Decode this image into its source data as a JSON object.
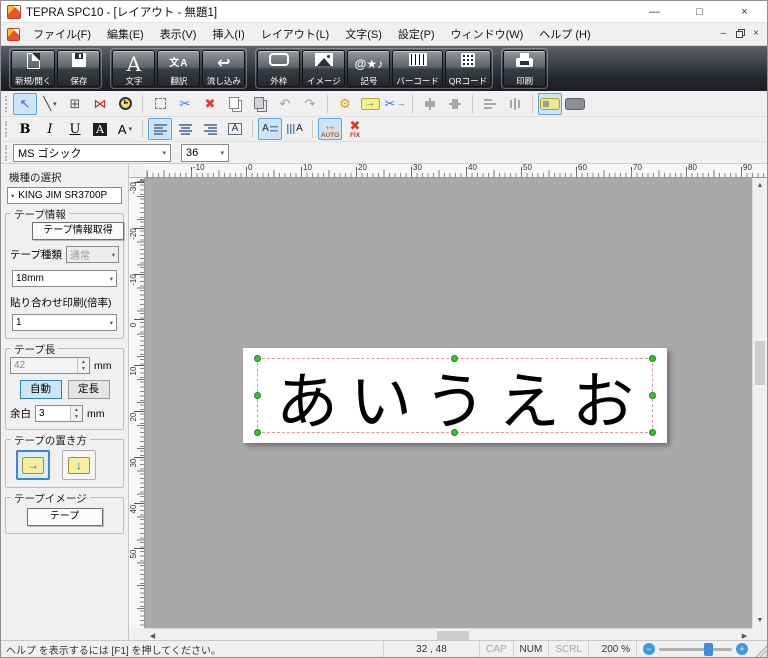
{
  "window": {
    "title": "TEPRA SPC10 - [レイアウト - 無題1]"
  },
  "menu": {
    "items": [
      "ファイル(F)",
      "編集(E)",
      "表示(V)",
      "挿入(I)",
      "レイアウト(L)",
      "文字(S)",
      "設定(P)",
      "ウィンドウ(W)",
      "ヘルプ (H)"
    ]
  },
  "icons": {
    "caret": "▾",
    "minimize": "—",
    "maximize": "□",
    "close": "×",
    "child_minimize": "‒",
    "child_close": "×",
    "combo_arrow": "▾",
    "spin_up": "▲",
    "spin_down": "▼",
    "scroll_up": "▲",
    "scroll_down": "▼",
    "scroll_left": "◀",
    "scroll_right": "▶",
    "zoom_out": "−",
    "zoom_in": "+"
  },
  "toolbar_main": {
    "groups": [
      [
        {
          "name": "new-open",
          "icon": "new",
          "glyph": "",
          "label": "新規/開く"
        },
        {
          "name": "save",
          "icon": "save",
          "glyph": "",
          "label": "保存"
        }
      ],
      [
        {
          "name": "text",
          "icon": "text",
          "glyph": "A",
          "label": "文字"
        },
        {
          "name": "translate",
          "icon": "translate",
          "glyph": "文A",
          "label": "翻訳"
        },
        {
          "name": "flow-in",
          "icon": "flow",
          "glyph": "↩",
          "label": "流し込み"
        }
      ],
      [
        {
          "name": "outer-frame",
          "icon": "frame",
          "glyph": "",
          "label": "外枠"
        },
        {
          "name": "image",
          "icon": "image",
          "glyph": "",
          "label": "イメージ"
        },
        {
          "name": "symbol",
          "icon": "symbol",
          "glyph": "@★♪",
          "label": "記号"
        },
        {
          "name": "barcode",
          "icon": "barcode",
          "glyph": "",
          "label": "バーコード"
        },
        {
          "name": "qr-code",
          "icon": "qr",
          "glyph": "",
          "label": "QRコード"
        }
      ],
      [
        {
          "name": "print",
          "icon": "print",
          "glyph": "",
          "label": "印刷"
        }
      ]
    ]
  },
  "toolbar_edit": {
    "items": [
      {
        "name": "select-tool",
        "glyph": "↖",
        "color": "#2f6fce",
        "active": true
      },
      {
        "name": "line-tool",
        "glyph": "╲",
        "color": "#444444",
        "caret": true
      },
      {
        "name": "table-tool",
        "glyph": "⊞",
        "color": "#556"
      },
      {
        "name": "ribbon-tool",
        "glyph": "⋈",
        "color": "#cc2222"
      },
      {
        "name": "clock-tool",
        "css": "clock"
      },
      {
        "sep": true
      },
      {
        "name": "select-frame",
        "css": "dashedbox"
      },
      {
        "name": "cut",
        "glyph": "✂",
        "color": "#3a7bd5"
      },
      {
        "name": "delete",
        "glyph": "✖",
        "color": "#e03c31"
      },
      {
        "name": "copy",
        "css": "copy"
      },
      {
        "name": "paste",
        "css": "paste"
      },
      {
        "name": "undo",
        "glyph": "↶",
        "color": "#9aa0a6"
      },
      {
        "name": "redo",
        "glyph": "↷",
        "color": "#9aa0a6"
      },
      {
        "sep": true
      },
      {
        "name": "layout-properties",
        "glyph": "⚙",
        "color": "#d4a017"
      },
      {
        "name": "insert-block",
        "css": "chip",
        "glyph": "→",
        "color": "#2f5fd0"
      },
      {
        "name": "split-block",
        "glyph": "✂",
        "color": "#3a7bd5",
        "extra": "→"
      },
      {
        "sep": true
      },
      {
        "name": "align-center-horizontal",
        "css": "alignh",
        "disabled": true
      },
      {
        "name": "align-center-vertical",
        "css": "alignv",
        "disabled": true
      },
      {
        "sep": true
      },
      {
        "name": "distribute-horizontal",
        "css": "disth",
        "disabled": true
      },
      {
        "name": "distribute-vertical",
        "css": "distv",
        "disabled": true
      },
      {
        "sep": true
      },
      {
        "name": "tape-view-horizontal",
        "css": "tapeh",
        "active": true
      },
      {
        "name": "tape-view-vertical",
        "css": "tapev"
      }
    ]
  },
  "toolbar_text": {
    "items": [
      {
        "name": "bold",
        "glyph": "B",
        "cls": "g-b"
      },
      {
        "name": "italic",
        "glyph": "I",
        "cls": "g-i"
      },
      {
        "name": "underline",
        "glyph": "U",
        "cls": "g-u"
      },
      {
        "name": "reverse-text",
        "glyph": "A",
        "cls": "g-rev"
      },
      {
        "name": "text-style",
        "glyph": "A",
        "cls": "g-plain",
        "caret": true
      },
      {
        "sep": true
      },
      {
        "name": "align-left",
        "css": "al",
        "active": true
      },
      {
        "name": "align-center",
        "css": "ac"
      },
      {
        "name": "align-right",
        "css": "ar"
      },
      {
        "name": "text-frame",
        "glyph": "A",
        "cls": "g-box"
      },
      {
        "sep": true
      },
      {
        "name": "horizontal-text",
        "glyph": "A",
        "cls": "g-hl",
        "active": true
      },
      {
        "name": "vertical-text",
        "glyph": "A",
        "cls": "g-vl"
      },
      {
        "sep": true
      },
      {
        "name": "auto-length",
        "glyph": "↔",
        "color": "#e07a1f",
        "label": "AUTO",
        "active": true
      },
      {
        "name": "fixed-length",
        "glyph": "✖",
        "color": "#d43c31",
        "label": "FIX"
      }
    ]
  },
  "font_bar": {
    "font_name": "MS ゴシック",
    "font_size": "36"
  },
  "sidebar": {
    "model_label": "機種の選択",
    "model_value": "KING JIM SR3700P",
    "tape_info": {
      "legend": "テープ情報",
      "get_button": "テープ情報取得",
      "type_label": "テープ種類",
      "type_value": "通常",
      "width_value": "18mm",
      "scale_label": "貼り合わせ印刷(倍率)",
      "scale_value": "1"
    },
    "tape_length": {
      "legend": "テープ長",
      "value": "42",
      "unit": "mm",
      "auto_label": "自動",
      "fixed_label": "定長",
      "margin_label": "余白",
      "margin_value": "3",
      "margin_unit": "mm"
    },
    "orientation": {
      "legend": "テープの置き方",
      "horizontal_glyph": "→",
      "vertical_glyph": "↓"
    },
    "tape_image": {
      "legend": "テープイメージ",
      "button": "テープ"
    }
  },
  "rulers": {
    "h_labels": [
      "-10",
      "0",
      "10",
      "20",
      "30",
      "40",
      "50",
      "60",
      "70",
      "80",
      "90"
    ],
    "v_labels": [
      "-30",
      "-20",
      "-10",
      "0",
      "10",
      "20",
      "30",
      "40",
      "50"
    ]
  },
  "canvas": {
    "tape_text": "あいうえお"
  },
  "status": {
    "help": "ヘルプ を表示するには [F1] を押してください。",
    "coords": "32 , 48",
    "cap": "CAP",
    "num": "NUM",
    "scrl": "SCRL",
    "zoom": "200 %"
  }
}
